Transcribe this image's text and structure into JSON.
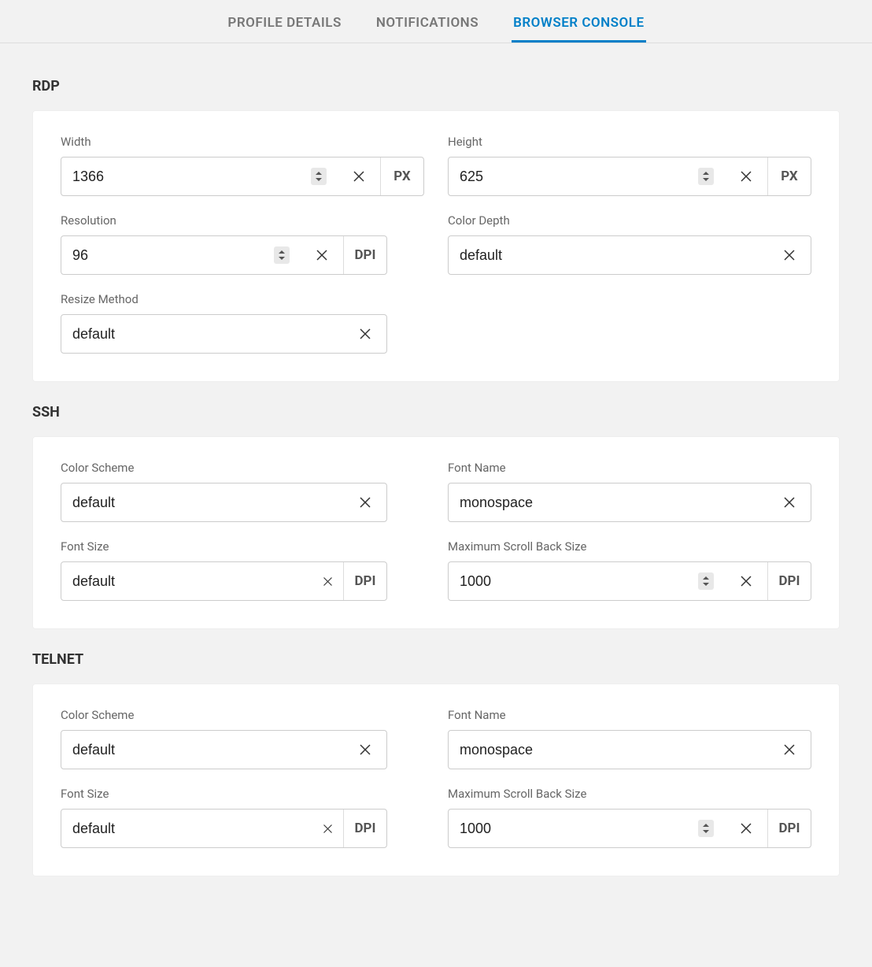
{
  "tabs": {
    "profile_details": "PROFILE DETAILS",
    "notifications": "NOTIFICATIONS",
    "browser_console": "BROWSER CONSOLE"
  },
  "suffixes": {
    "px": "PX",
    "dpi": "DPI"
  },
  "rdp": {
    "title": "RDP",
    "width_label": "Width",
    "width_value": "1366",
    "height_label": "Height",
    "height_value": "625",
    "resolution_label": "Resolution",
    "resolution_value": "96",
    "color_depth_label": "Color Depth",
    "color_depth_value": "default",
    "resize_method_label": "Resize Method",
    "resize_method_value": "default"
  },
  "ssh": {
    "title": "SSH",
    "color_scheme_label": "Color Scheme",
    "color_scheme_value": "default",
    "font_name_label": "Font Name",
    "font_name_value": "monospace",
    "font_size_label": "Font Size",
    "font_size_value": "default",
    "max_scroll_label": "Maximum Scroll Back Size",
    "max_scroll_value": "1000"
  },
  "telnet": {
    "title": "TELNET",
    "color_scheme_label": "Color Scheme",
    "color_scheme_value": "default",
    "font_name_label": "Font Name",
    "font_name_value": "monospace",
    "font_size_label": "Font Size",
    "font_size_value": "default",
    "max_scroll_label": "Maximum Scroll Back Size",
    "max_scroll_value": "1000"
  }
}
